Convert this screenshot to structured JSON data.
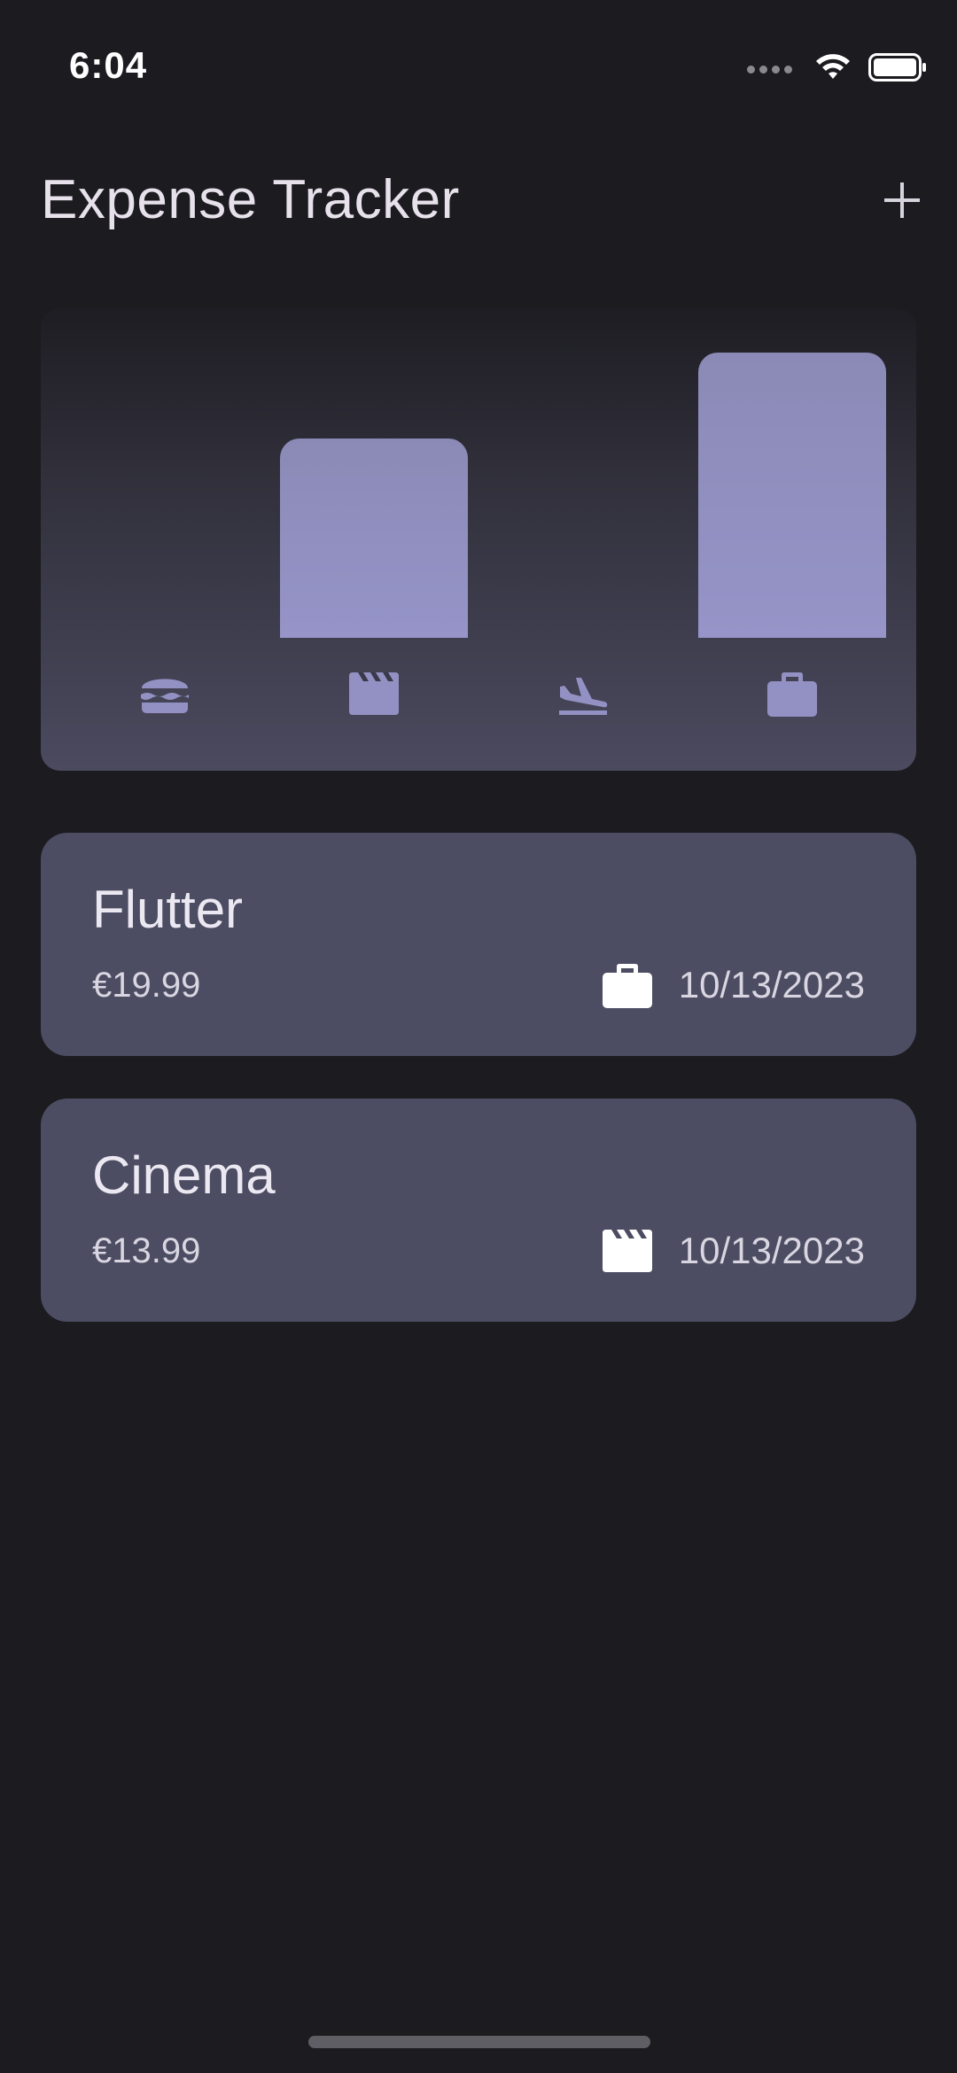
{
  "status_bar": {
    "time": "6:04"
  },
  "app_bar": {
    "title": "Expense Tracker",
    "add_icon": "plus-icon"
  },
  "chart": {
    "type": "bar",
    "categories": [
      "food",
      "leisure",
      "travel",
      "work"
    ],
    "category_icons": [
      "burger-icon",
      "clapperboard-icon",
      "airplane-landing-icon",
      "briefcase-icon"
    ],
    "values": [
      0,
      13.99,
      0,
      19.99
    ],
    "bar_color": "#9391c3"
  },
  "expenses": [
    {
      "title": "Flutter",
      "amount": "€19.99",
      "date": "10/13/2023",
      "category_icon": "briefcase-icon"
    },
    {
      "title": "Cinema",
      "amount": "€13.99",
      "date": "10/13/2023",
      "category_icon": "clapperboard-icon"
    }
  ],
  "colors": {
    "background": "#1c1b20",
    "card": "#4c4c62",
    "accent": "#9391c3"
  }
}
